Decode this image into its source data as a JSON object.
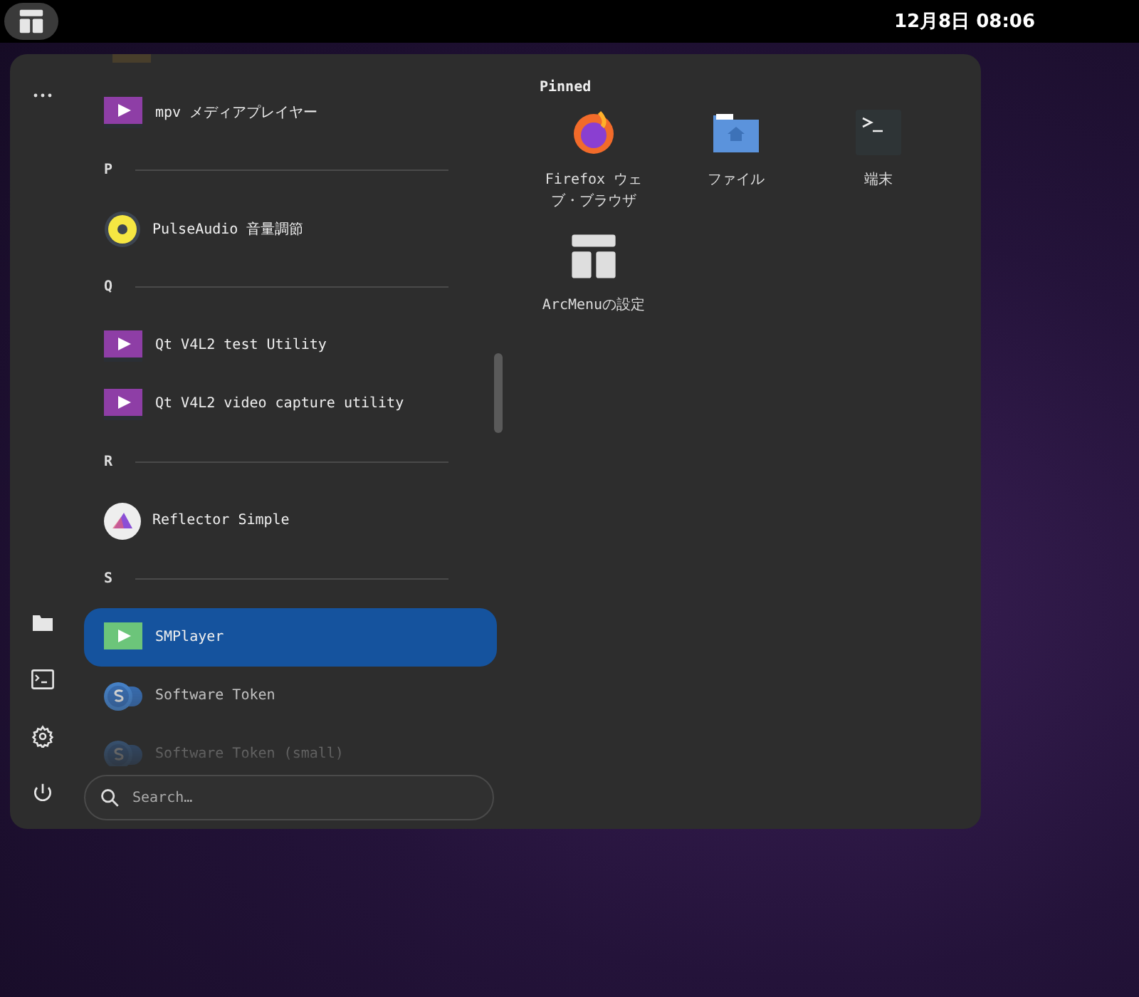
{
  "top_bar": {
    "clock": "12月8日 08:06"
  },
  "app_list": [
    {
      "kind": "app",
      "label": "mpv メディアプレイヤー",
      "selected": false
    },
    {
      "kind": "header",
      "label": "P"
    },
    {
      "kind": "app",
      "label": "PulseAudio 音量調節",
      "selected": false
    },
    {
      "kind": "header",
      "label": "Q"
    },
    {
      "kind": "app",
      "label": "Qt V4L2 test Utility",
      "selected": false
    },
    {
      "kind": "app",
      "label": "Qt V4L2 video capture utility",
      "selected": false
    },
    {
      "kind": "header",
      "label": "R"
    },
    {
      "kind": "app",
      "label": "Reflector Simple",
      "selected": false
    },
    {
      "kind": "header",
      "label": "S"
    },
    {
      "kind": "app",
      "label": "SMPlayer",
      "selected": true
    },
    {
      "kind": "app",
      "label": "Software Token",
      "selected": false
    },
    {
      "kind": "app",
      "label": "Software Token (small)",
      "selected": false
    }
  ],
  "search": {
    "placeholder": "Search…"
  },
  "pinned": {
    "title": "Pinned",
    "items": [
      {
        "label": "Firefox ウェブ・ブラウザ"
      },
      {
        "label": "ファイル"
      },
      {
        "label": "端末"
      },
      {
        "label": "ArcMenuの設定"
      }
    ]
  }
}
